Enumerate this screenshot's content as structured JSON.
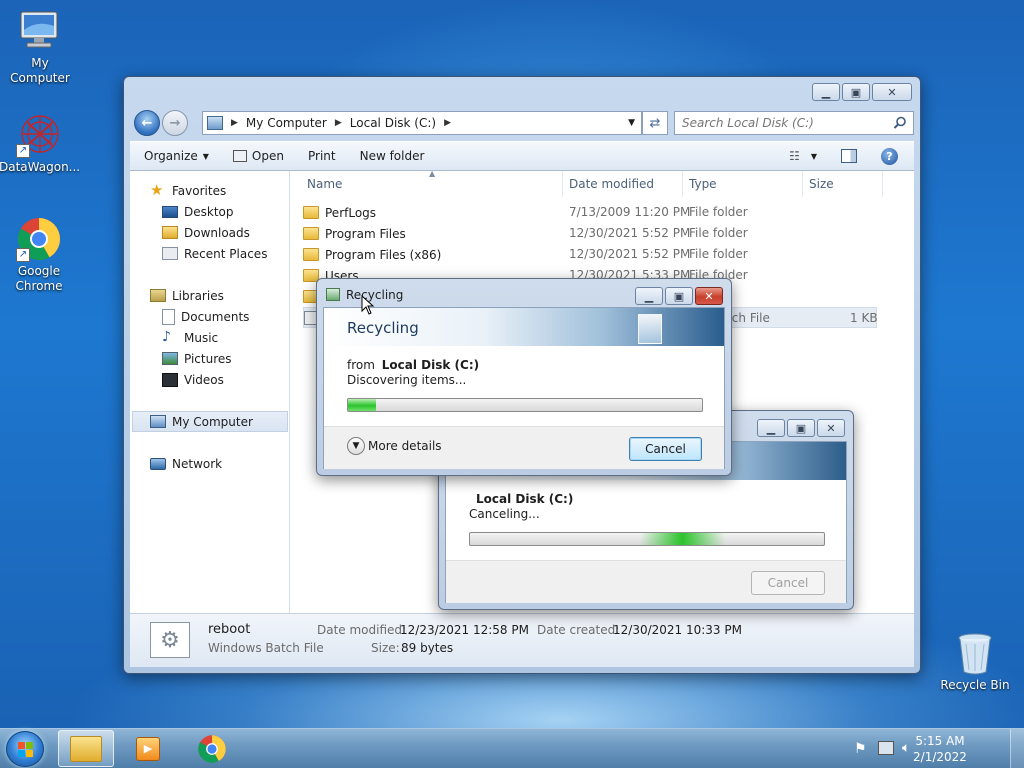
{
  "desktop": {
    "icons": [
      {
        "label": "My Computer",
        "icon": "computer-icon"
      },
      {
        "label": "DataWagon...",
        "icon": "datawagon-icon"
      },
      {
        "label": "Google Chrome",
        "icon": "chrome-icon"
      },
      {
        "label": "Recycle Bin",
        "icon": "recycle-bin-icon"
      }
    ]
  },
  "explorer": {
    "address": [
      "My Computer",
      "Local Disk (C:)"
    ],
    "search_placeholder": "Search Local Disk (C:)",
    "commands": {
      "organize": "Organize",
      "open": "Open",
      "print": "Print",
      "new_folder": "New folder"
    },
    "nav": {
      "favorites": "Favorites",
      "favorites_items": [
        "Desktop",
        "Downloads",
        "Recent Places"
      ],
      "libraries": "Libraries",
      "libraries_items": [
        "Documents",
        "Music",
        "Pictures",
        "Videos"
      ],
      "my_computer": "My Computer",
      "network": "Network"
    },
    "columns": {
      "name": "Name",
      "date": "Date modified",
      "type": "Type",
      "size": "Size"
    },
    "files": [
      {
        "name": "PerfLogs",
        "date": "7/13/2009 11:20 PM",
        "type": "File folder",
        "size": ""
      },
      {
        "name": "Program Files",
        "date": "12/30/2021 5:52 PM",
        "type": "File folder",
        "size": ""
      },
      {
        "name": "Program Files (x86)",
        "date": "12/30/2021 5:52 PM",
        "type": "File folder",
        "size": ""
      },
      {
        "name": "Users",
        "date": "12/30/2021 5:33 PM",
        "type": "File folder",
        "size": ""
      },
      {
        "name": "",
        "date": "",
        "type": "...der",
        "size": ""
      },
      {
        "name": "",
        "date": "",
        "type": "...s Batch File",
        "size": "1 KB"
      }
    ],
    "details": {
      "name": "reboot",
      "kind": "Windows Batch File",
      "modified_label": "Date modified:",
      "modified": "12/23/2021 12:58 PM",
      "created_label": "Date created:",
      "created": "12/30/2021 10:33 PM",
      "size_label": "Size:",
      "size": "89 bytes"
    }
  },
  "recycling_dialog": {
    "title": "Recycling",
    "heading": "Recycling",
    "from_label": "from",
    "from_value": "Local Disk (C:)",
    "status": "Discovering items...",
    "progress_fraction": 0.08,
    "more_details": "More details",
    "cancel": "Cancel"
  },
  "canceling_dialog": {
    "drive": "Local Disk (C:)",
    "status": "Canceling...",
    "progress_marquee_center": 0.6,
    "cancel": "Cancel"
  },
  "taskbar": {
    "time": "5:15 AM",
    "date": "2/1/2022"
  }
}
